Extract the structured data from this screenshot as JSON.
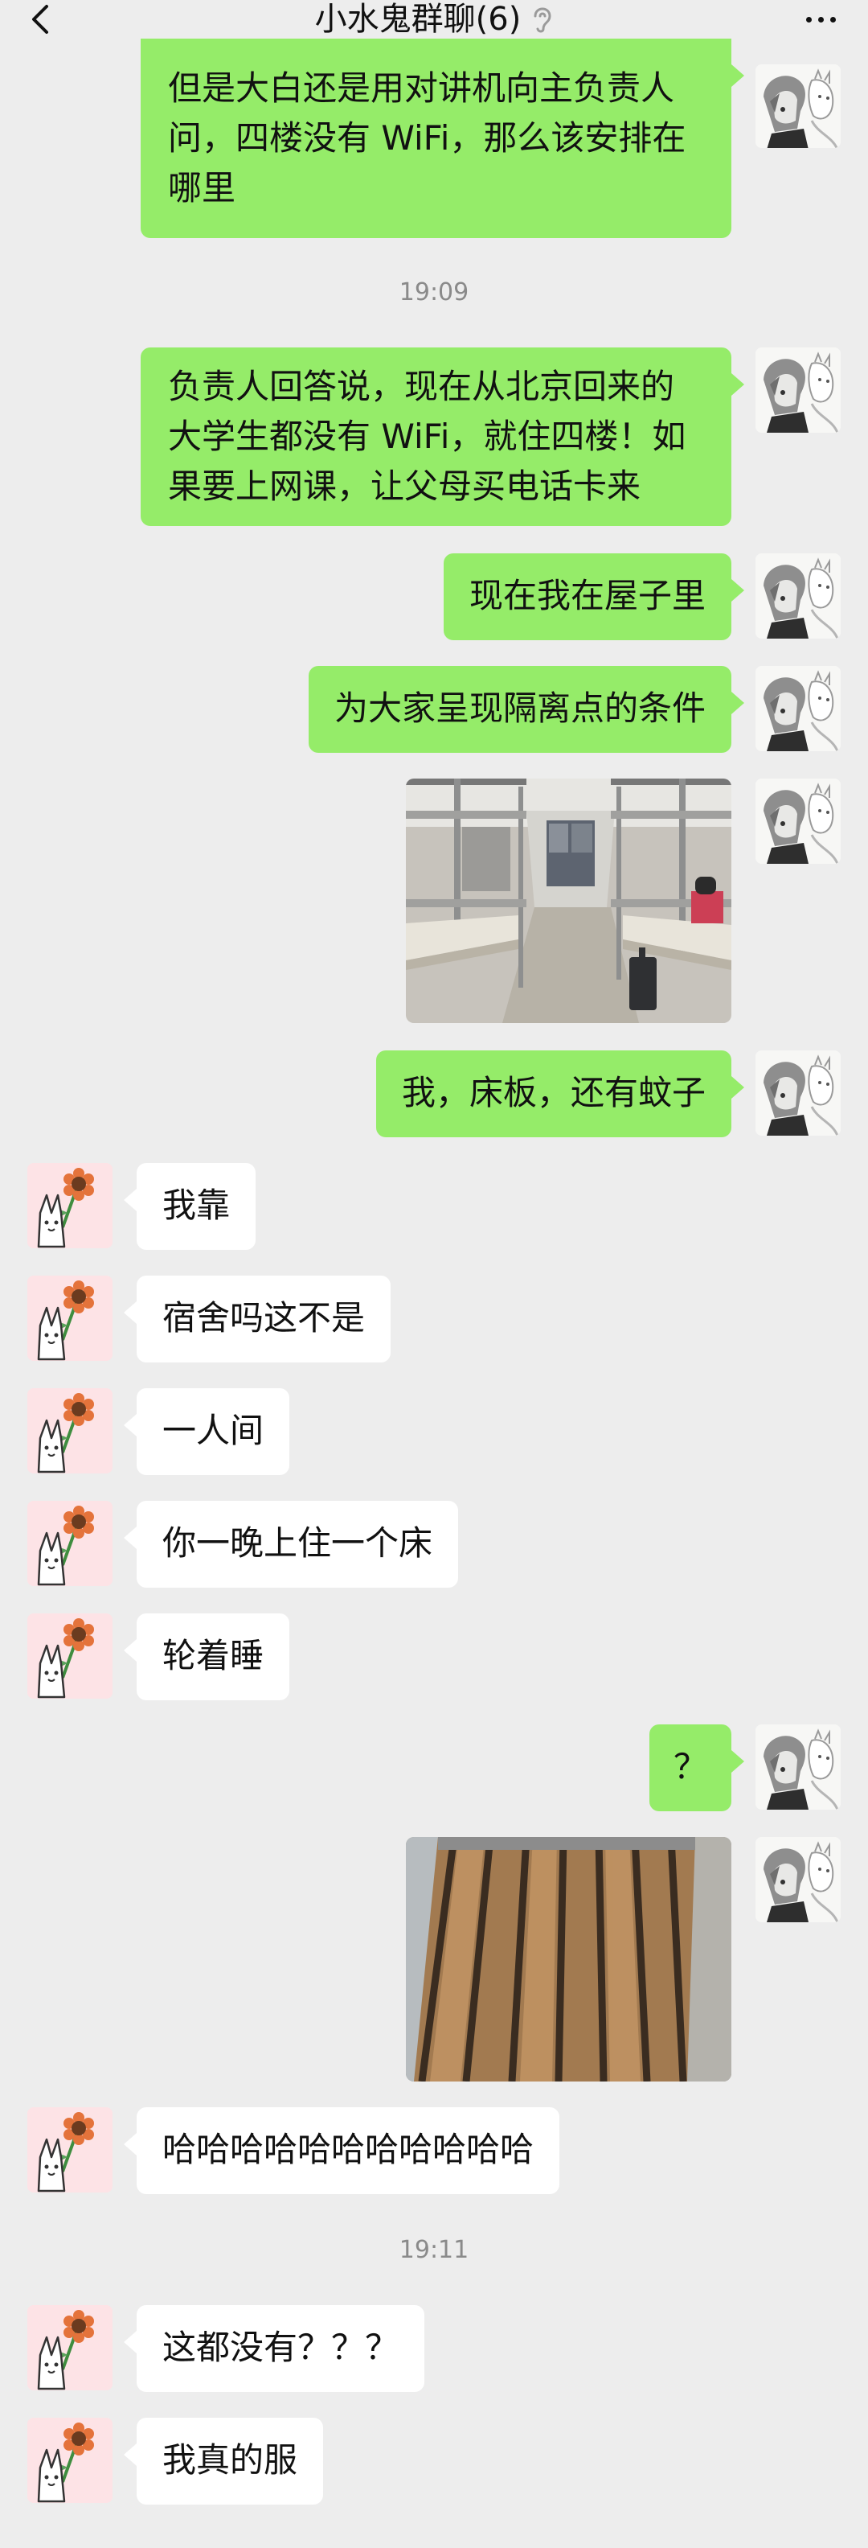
{
  "header": {
    "title": "小水鬼群聊(6)"
  },
  "messages": [
    {
      "text": "但是大白还是用对讲机向主负责人问，四楼没有 WiFi，那么该安排在哪里"
    },
    {
      "time": "19:09"
    },
    {
      "text": "负责人回答说，现在从北京回来的大学生都没有 WiFi，就住四楼！如果要上网课，让父母买电话卡来"
    },
    {
      "text": "现在我在屋子里"
    },
    {
      "text": "为大家呈现隔离点的条件"
    },
    {
      "text": "我，床板，还有蚊子"
    },
    {
      "text": "我靠"
    },
    {
      "text": "宿舍吗这不是"
    },
    {
      "text": "一人间"
    },
    {
      "text": "你一晚上住一个床"
    },
    {
      "text": "轮着睡"
    },
    {
      "text": "？"
    },
    {
      "text": "哈哈哈哈哈哈哈哈哈哈哈"
    },
    {
      "time": "19:11"
    },
    {
      "text": "这都没有？？？"
    },
    {
      "text": "我真的服"
    }
  ],
  "colors": {
    "sent_bubble": "#95ec69",
    "received_bubble": "#ffffff",
    "background": "#ededed"
  },
  "icons": {
    "back": "chevron-left-icon",
    "ear": "ear-icon",
    "more": "more-dots-icon"
  }
}
